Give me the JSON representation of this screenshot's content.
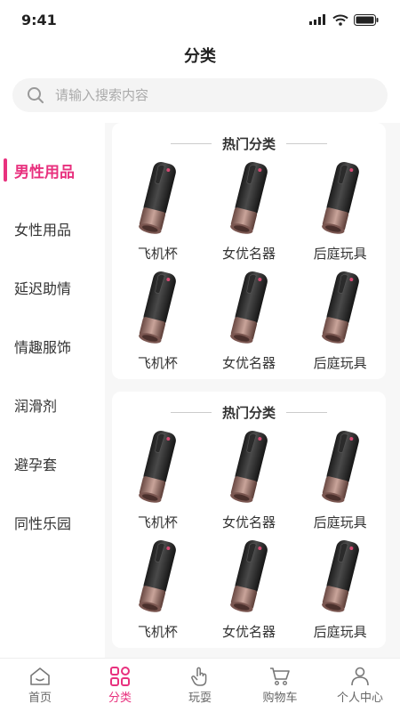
{
  "status": {
    "time": "9:41"
  },
  "header": {
    "title": "分类"
  },
  "search": {
    "placeholder": "请输入搜索内容"
  },
  "sidebar": {
    "items": [
      {
        "label": "男性用品"
      },
      {
        "label": "女性用品"
      },
      {
        "label": "延迟助情"
      },
      {
        "label": "情趣服饰"
      },
      {
        "label": "润滑剂"
      },
      {
        "label": "避孕套"
      },
      {
        "label": "同性乐园"
      }
    ]
  },
  "sections": [
    {
      "title": "热门分类",
      "items": [
        {
          "label": "飞机杯"
        },
        {
          "label": "女优名器"
        },
        {
          "label": "后庭玩具"
        },
        {
          "label": "飞机杯"
        },
        {
          "label": "女优名器"
        },
        {
          "label": "后庭玩具"
        }
      ]
    },
    {
      "title": "热门分类",
      "items": [
        {
          "label": "飞机杯"
        },
        {
          "label": "女优名器"
        },
        {
          "label": "后庭玩具"
        },
        {
          "label": "飞机杯"
        },
        {
          "label": "女优名器"
        },
        {
          "label": "后庭玩具"
        }
      ]
    }
  ],
  "tabbar": {
    "items": [
      {
        "label": "首页",
        "icon": "home-icon"
      },
      {
        "label": "分类",
        "icon": "category-icon"
      },
      {
        "label": "玩耍",
        "icon": "hand-icon"
      },
      {
        "label": "购物车",
        "icon": "cart-icon"
      },
      {
        "label": "个人中心",
        "icon": "user-icon"
      }
    ]
  },
  "colors": {
    "accent": "#e8317e"
  }
}
